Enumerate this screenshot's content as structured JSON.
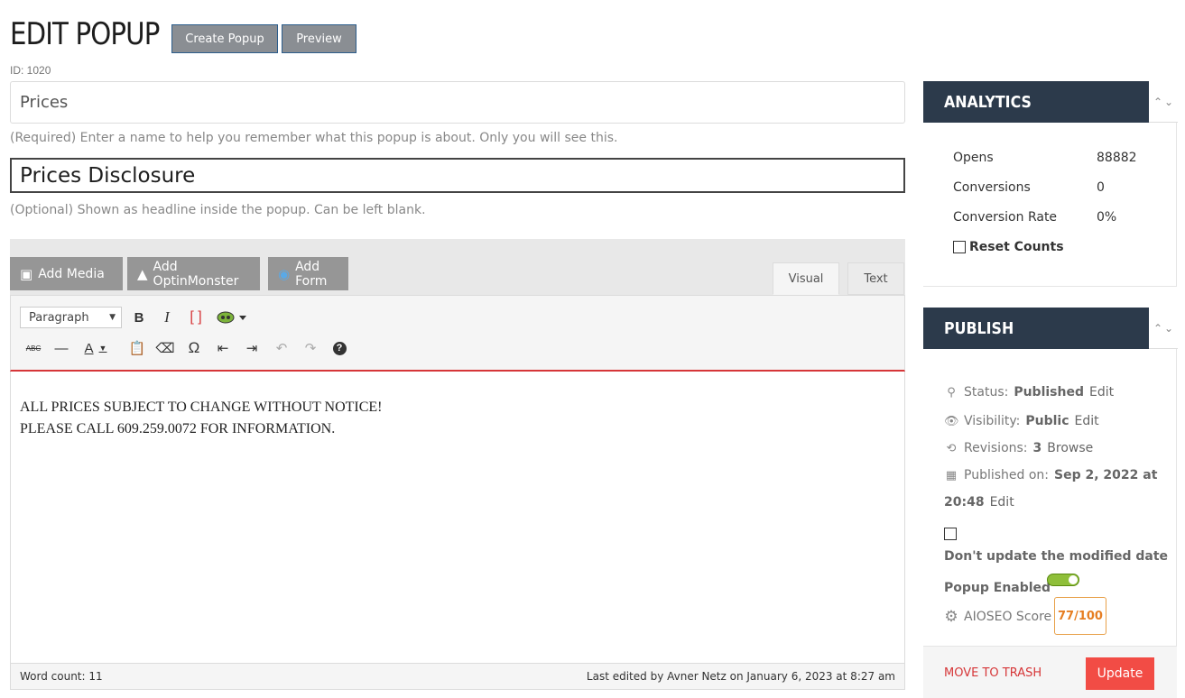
{
  "header": {
    "title": "EDIT POPUP",
    "create_label": "Create Popup",
    "preview_label": "Preview",
    "post_id": "ID: 1020"
  },
  "form": {
    "name_value": "Prices",
    "name_hint": "(Required) Enter a name to help you remember what this popup is about. Only you will see this.",
    "headline_value": "Prices Disclosure",
    "headline_hint": "(Optional) Shown as headline inside the popup. Can be left blank."
  },
  "editor": {
    "media_buttons": [
      "Add Media",
      "Add OptinMonster",
      "Add Form"
    ],
    "tabs": [
      "Visual",
      "Text"
    ],
    "format_select": "Paragraph",
    "content_lines": [
      "ALL PRICES SUBJECT TO CHANGE WITHOUT NOTICE!",
      "PLEASE CALL 609.259.0072 FOR INFORMATION."
    ],
    "word_count": "Word count: 11",
    "last_edited": "Last edited by Avner Netz on January 6, 2023 at 8:27 am",
    "toolbar_icons": [
      "bold-icon",
      "italic-icon",
      "shortcode-icon",
      "optinmonster-icon",
      "strikethrough-icon",
      "horizontal-line-icon",
      "text-color-icon",
      "paste-text-icon",
      "clear-formatting-icon",
      "special-character-icon",
      "outdent-icon",
      "indent-icon",
      "undo-icon",
      "redo-icon",
      "help-icon"
    ]
  },
  "analytics": {
    "title": "ANALYTICS",
    "rows": [
      {
        "label": "Opens",
        "value": "88882"
      },
      {
        "label": "Conversions",
        "value": "0"
      },
      {
        "label": "Conversion Rate",
        "value": "0%"
      }
    ],
    "reset_label": "Reset Counts"
  },
  "publish": {
    "title": "PUBLISH",
    "status_label": "Status:",
    "status_value": "Published",
    "visibility_label": "Visibility:",
    "visibility_value": "Public",
    "revisions_label": "Revisions:",
    "revisions_value": "3",
    "browse_label": "Browse",
    "published_label": "Published on:",
    "published_date": "Sep 2, 2022 at",
    "published_time": "20:48",
    "edit_label": "Edit",
    "modified_label": "Don't update the modified date",
    "enabled_label": "Popup Enabled",
    "aioseo_label": "AIOSEO Score",
    "aioseo_score": "77/100",
    "trash_label": "MOVE TO TRASH",
    "update_label": "Update"
  },
  "colors": {
    "panel_header": "#2c3a4b",
    "update_button": "#f24c45",
    "toggle_on": "#8fbf3a",
    "score": "#e67e22"
  }
}
